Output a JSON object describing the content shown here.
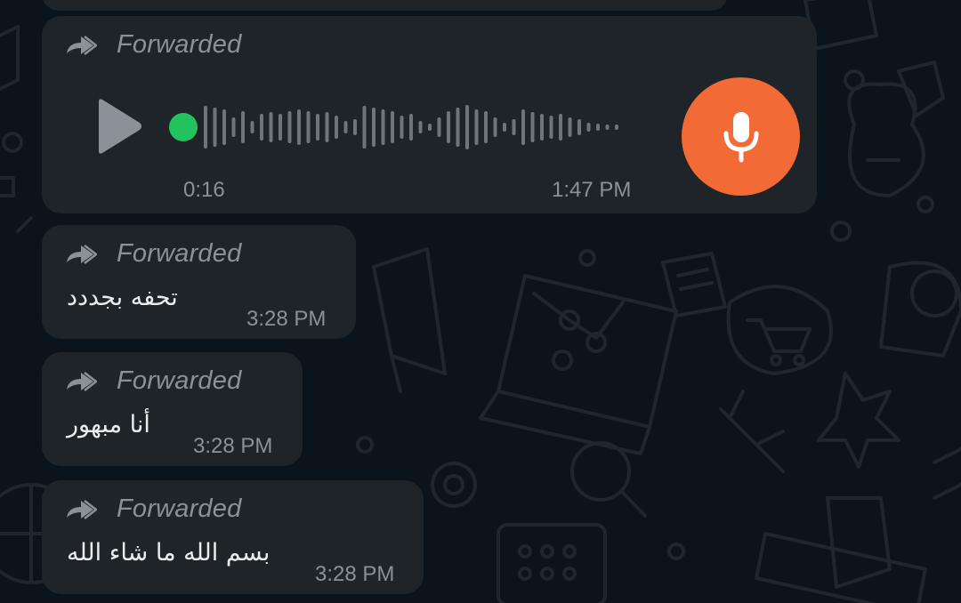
{
  "colors": {
    "background": "#0b141a",
    "bubble": "#1f2428",
    "meta_text": "#8a9298",
    "message_text": "#e9edef",
    "mic_button": "#f26a35",
    "voice_dot": "#22c35e"
  },
  "messages": [
    {
      "type": "voice",
      "forwarded_label": "Forwarded",
      "duration": "0:16",
      "time": "1:47 PM",
      "icons": [
        "forward-icon",
        "play-icon",
        "microphone-icon"
      ]
    },
    {
      "type": "text",
      "forwarded_label": "Forwarded",
      "text": "تحفه بجددد",
      "time": "3:28 PM"
    },
    {
      "type": "text",
      "forwarded_label": "Forwarded",
      "text": "أنا مبهور",
      "time": "3:28 PM"
    },
    {
      "type": "text",
      "forwarded_label": "Forwarded",
      "text": "بسم الله ما شاء الله",
      "time": "3:28 PM"
    }
  ]
}
